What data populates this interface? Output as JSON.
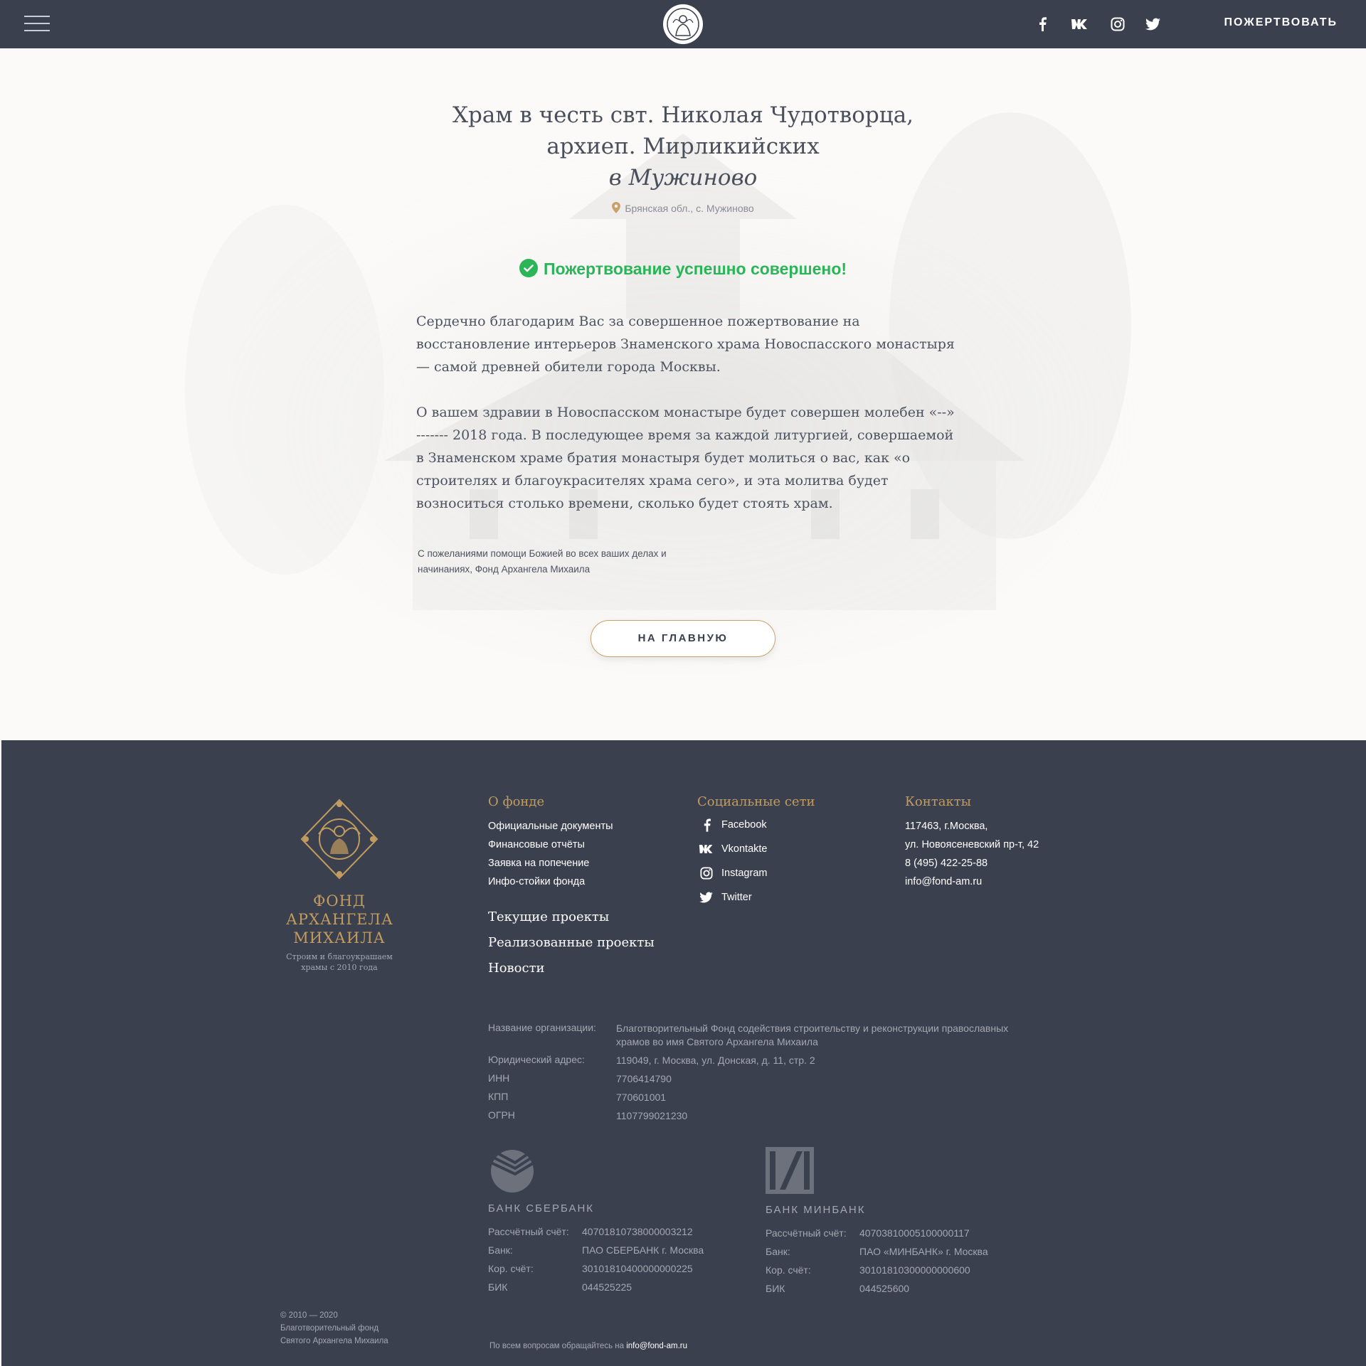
{
  "header": {
    "menu_icon": "hamburger-menu-icon",
    "logo_icon": "archangel-emblem-icon",
    "social": [
      "facebook-icon",
      "vk-icon",
      "instagram-icon",
      "twitter-icon"
    ],
    "donate_label": "ПОЖЕРТВОВАТЬ"
  },
  "main": {
    "title_line1": "Храм в честь свт. Николая Чудотворца,",
    "title_line2": "архиеп. Мирликийских",
    "title_line3": "в Мужиново",
    "location": "Брянская обл., с. Мужиново",
    "success": "Пожертвование успешно совершено!",
    "paragraph1": "Сердечно благодарим Вас за совершенное пожертвование на восстановление интерьеров Знаменского храма Новоспасского монастыря — самой древней обители города Москвы.",
    "paragraph2": "О вашем здравии в Новоспасском монастыре будет совершен молебен «--» ------- 2018 года. В последующее время за каждой литургией, совершаемой в Знаменском храме братия монастыря будет молиться о вас, как «о строителях и благоукрасителях храма сего», и эта молитва будет возноситься столько времени, сколько будет стоять храм.",
    "signature": "С пожеланиями помощи Божией во всех ваших делах и начинаниях, Фонд Архангела Михаила",
    "home_button": "НА ГЛАВНУЮ"
  },
  "footer": {
    "logo_name_1": "ФОНД",
    "logo_name_2": "АРХАНГЕЛА",
    "logo_name_3": "МИХАИЛА",
    "logo_tagline": "Строим и благоукрашаем храмы с 2010 года",
    "about_title": "О фонде",
    "about_links": [
      "Официальные документы",
      "Финансовые отчёты",
      "Заявка на попечение",
      "Инфо-стойки фонда"
    ],
    "big_links": [
      "Текущие проекты",
      "Реализованные проекты",
      "Новости"
    ],
    "social_title": "Социальные сети",
    "social_links": [
      {
        "icon": "facebook-icon",
        "label": "Facebook"
      },
      {
        "icon": "vk-icon",
        "label": "Vkontakte"
      },
      {
        "icon": "instagram-icon",
        "label": "Instagram"
      },
      {
        "icon": "twitter-icon",
        "label": "Twitter"
      }
    ],
    "contacts_title": "Контакты",
    "contacts": [
      "117463, г.Москва,",
      "ул. Новоясеневский пр-т, 42",
      "8 (495) 422-25-88",
      "info@fond-am.ru"
    ],
    "requisites": [
      {
        "label": "Название организации:",
        "value": "Благотворительный Фонд содействия строительству и реконструкции православных храмов во имя Святого Архангела Михаила"
      },
      {
        "label": "Юридический адрес:",
        "value": "119049, г. Москва, ул. Донская, д. 11, стр. 2"
      },
      {
        "label": "ИНН",
        "value": "7706414790"
      },
      {
        "label": "КПП",
        "value": "770601001"
      },
      {
        "label": "ОГРН",
        "value": "1107799021230"
      }
    ],
    "banks": [
      {
        "icon": "sberbank-logo-icon",
        "name": "БАНК СБЕРБАНК",
        "rows": [
          {
            "label": "Рассчётный счёт:",
            "value": "40701810738000003212"
          },
          {
            "label": "Банк:",
            "value": "ПАО СБЕРБАНК г. Москва"
          },
          {
            "label": "Кор. счёт:",
            "value": "30101810400000000225"
          },
          {
            "label": "БИК",
            "value": "044525225"
          }
        ]
      },
      {
        "icon": "minbank-logo-icon",
        "name": "БАНК МИНБАНК",
        "rows": [
          {
            "label": "Рассчётный счёт:",
            "value": "40703810005100000117"
          },
          {
            "label": "Банк:",
            "value": "ПАО «МИНБАНК» г. Москва"
          },
          {
            "label": "Кор. счёт:",
            "value": "30101810300000000600"
          },
          {
            "label": "БИК",
            "value": "044525600"
          }
        ]
      }
    ],
    "copyright_1": "© 2010 — 2020",
    "copyright_2": "Благотворительный фонд",
    "copyright_3": "Святого Архангела Михаила",
    "contact_note": "По всем вопросам обращайтесь на",
    "contact_email": "info@fond-am.ru"
  },
  "colors": {
    "header_bg": "#3b404f",
    "footer_bg": "#3b404f",
    "gold": "#c29b5e",
    "success_green": "#2bb558",
    "page_bg": "#fbfaf8"
  }
}
